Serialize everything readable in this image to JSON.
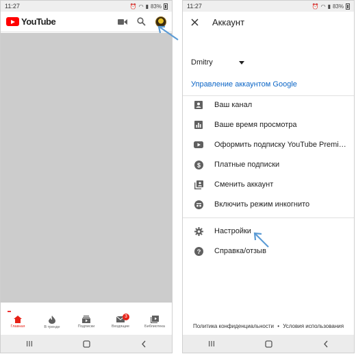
{
  "status_bar": {
    "time": "11:27",
    "battery": "83%"
  },
  "left": {
    "logo_text": "YouTube",
    "nav": [
      {
        "label": "Главная",
        "icon": "home-icon",
        "active": true
      },
      {
        "label": "В тренде",
        "icon": "trending-icon",
        "active": false
      },
      {
        "label": "Подписки",
        "icon": "subscriptions-icon",
        "active": false
      },
      {
        "label": "Входящие",
        "icon": "inbox-icon",
        "active": false,
        "badge": "3"
      },
      {
        "label": "Библиотека",
        "icon": "library-icon",
        "active": false
      }
    ]
  },
  "right": {
    "title": "Аккаунт",
    "username": "Dmitry",
    "manage_link": "Управление аккаунтом Google",
    "menu": [
      {
        "label": "Ваш канал",
        "icon": "channel-icon"
      },
      {
        "label": "Ваше время просмотра",
        "icon": "watch-time-icon"
      },
      {
        "label": "Оформить подписку YouTube Premi…",
        "icon": "youtube-premium-icon"
      },
      {
        "label": "Платные подписки",
        "icon": "paid-subscriptions-icon"
      },
      {
        "label": "Сменить аккаунт",
        "icon": "switch-account-icon"
      },
      {
        "label": "Включить режим инкогнито",
        "icon": "incognito-icon"
      },
      {
        "label": "Настройки",
        "icon": "settings-icon"
      },
      {
        "label": "Справка/отзыв",
        "icon": "help-icon"
      }
    ],
    "footer": {
      "privacy": "Политика конфиденциальности",
      "separator": "•",
      "terms": "Условия использования"
    }
  },
  "colors": {
    "youtube_red": "#ff0000",
    "link_blue": "#0b65c6",
    "arrow_blue": "#5b9bd5",
    "placeholder_gray": "#cccccc"
  }
}
